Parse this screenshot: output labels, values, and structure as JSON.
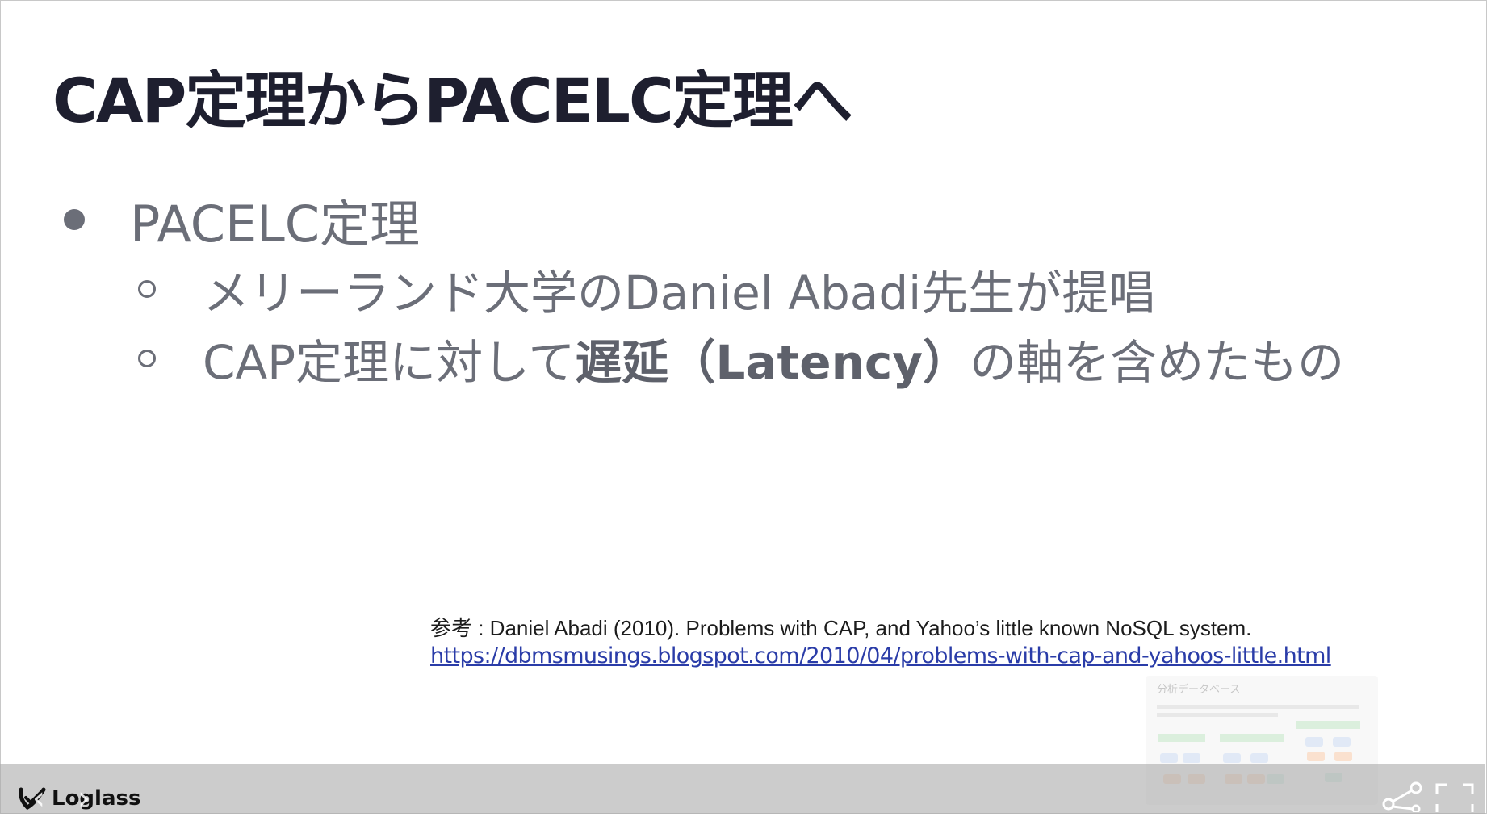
{
  "slide": {
    "title": "CAP定理からPACELC定理へ",
    "bullet_main": "PACELC定理",
    "sub1": "メリーランド大学のDaniel Abadi先生が提唱",
    "sub2_pre": "CAP定理に対して",
    "sub2_bold": "遅延（Latency）",
    "sub2_post": "の軸を含めたもの",
    "reference_text": "参考 : Daniel Abadi (2010). Problems with CAP, and Yahoo’s little known NoSQL system.",
    "reference_url": "https://dbmsmusings.blogspot.com/2010/04/problems-with-cap-and-yahoos-little.html"
  },
  "thumbnail": {
    "title": "分析データベース"
  },
  "toolbar": {
    "logo_text": "Loglass",
    "prev_glyph": "‹",
    "next_glyph": "›"
  },
  "colors": {
    "title": "#1e1f2f",
    "body": "#6b6e78",
    "link": "#2a3ca8"
  }
}
